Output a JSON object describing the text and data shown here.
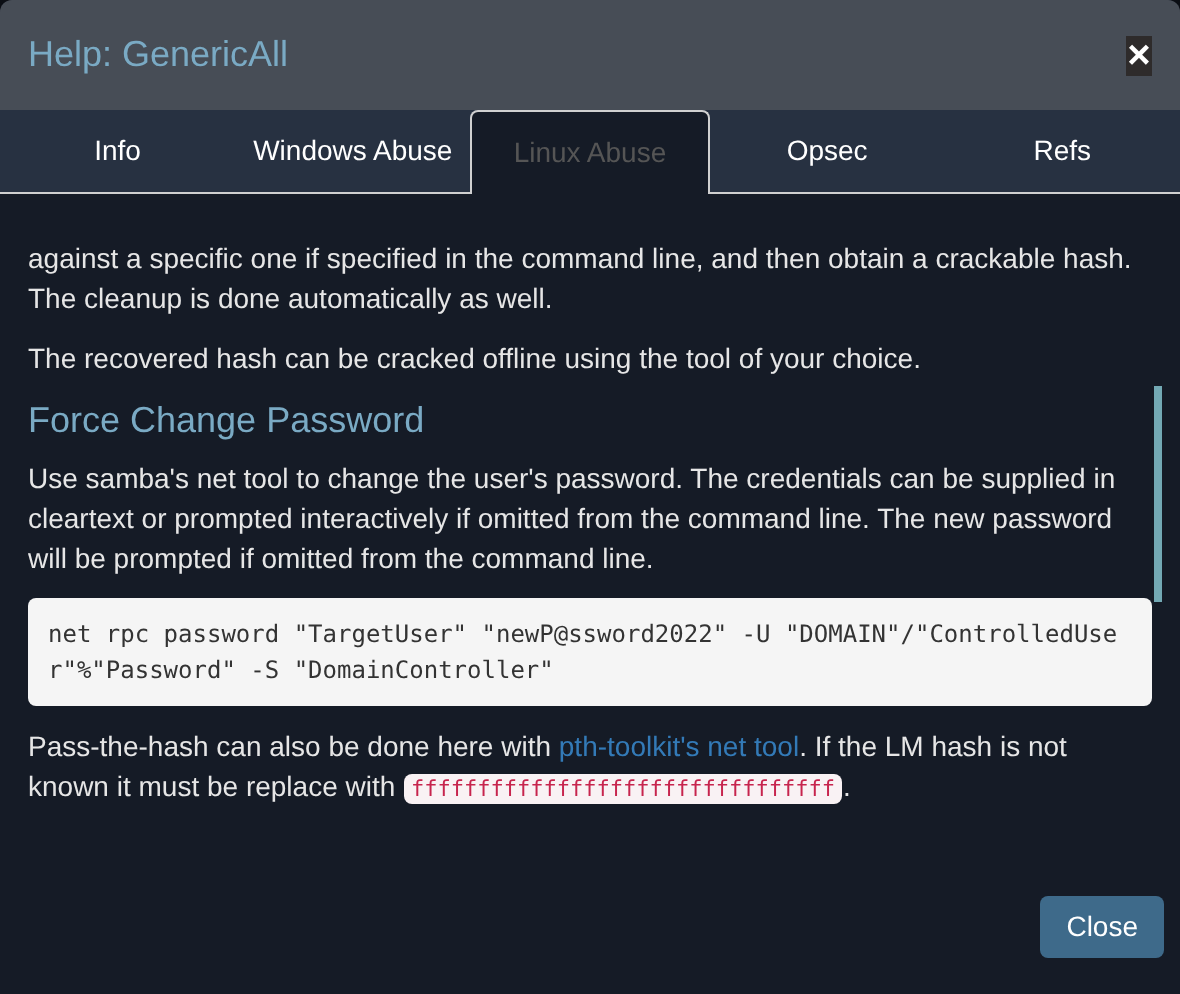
{
  "window": {
    "title": "Help: GenericAll",
    "close": "×"
  },
  "tabs": [
    {
      "label": "Info",
      "selected": false
    },
    {
      "label": "Windows Abuse",
      "selected": false
    },
    {
      "label": "Linux Abuse",
      "selected": true
    },
    {
      "label": "Opsec",
      "selected": false
    },
    {
      "label": "Refs",
      "selected": false
    }
  ],
  "content": [
    {
      "kind": "paragraph",
      "text": "against a specific one if specified in the command line, and then obtain a crackable hash. The cleanup is done automatically as well."
    },
    {
      "kind": "paragraph",
      "text": "The recovered hash can be cracked offline using the tool of your choice."
    },
    {
      "kind": "heading",
      "text": "Force Change Password"
    },
    {
      "kind": "paragraph",
      "text": "Use samba's net tool to change the user's password. The credentials can be supplied in cleartext or prompted interactively if omitted from the command line. The new password will be prompted if omitted from the command line."
    },
    {
      "kind": "code",
      "text": "net rpc password \"TargetUser\" \"newP@ssword2022\" -U \"DOMAIN\"/\"ControlledUser\"%\"Password\" -S \"DomainController\""
    },
    {
      "kind": "mixed",
      "before": "Pass-the-hash can also be done here with ",
      "link": "pth-toolkit's net tool",
      "middle": ". If the LM hash is not known it must be replace with ",
      "code": "ffffffffffffffffffffffffffffffff",
      "after": "."
    }
  ],
  "buttons": [
    {
      "label": "Close"
    }
  ]
}
